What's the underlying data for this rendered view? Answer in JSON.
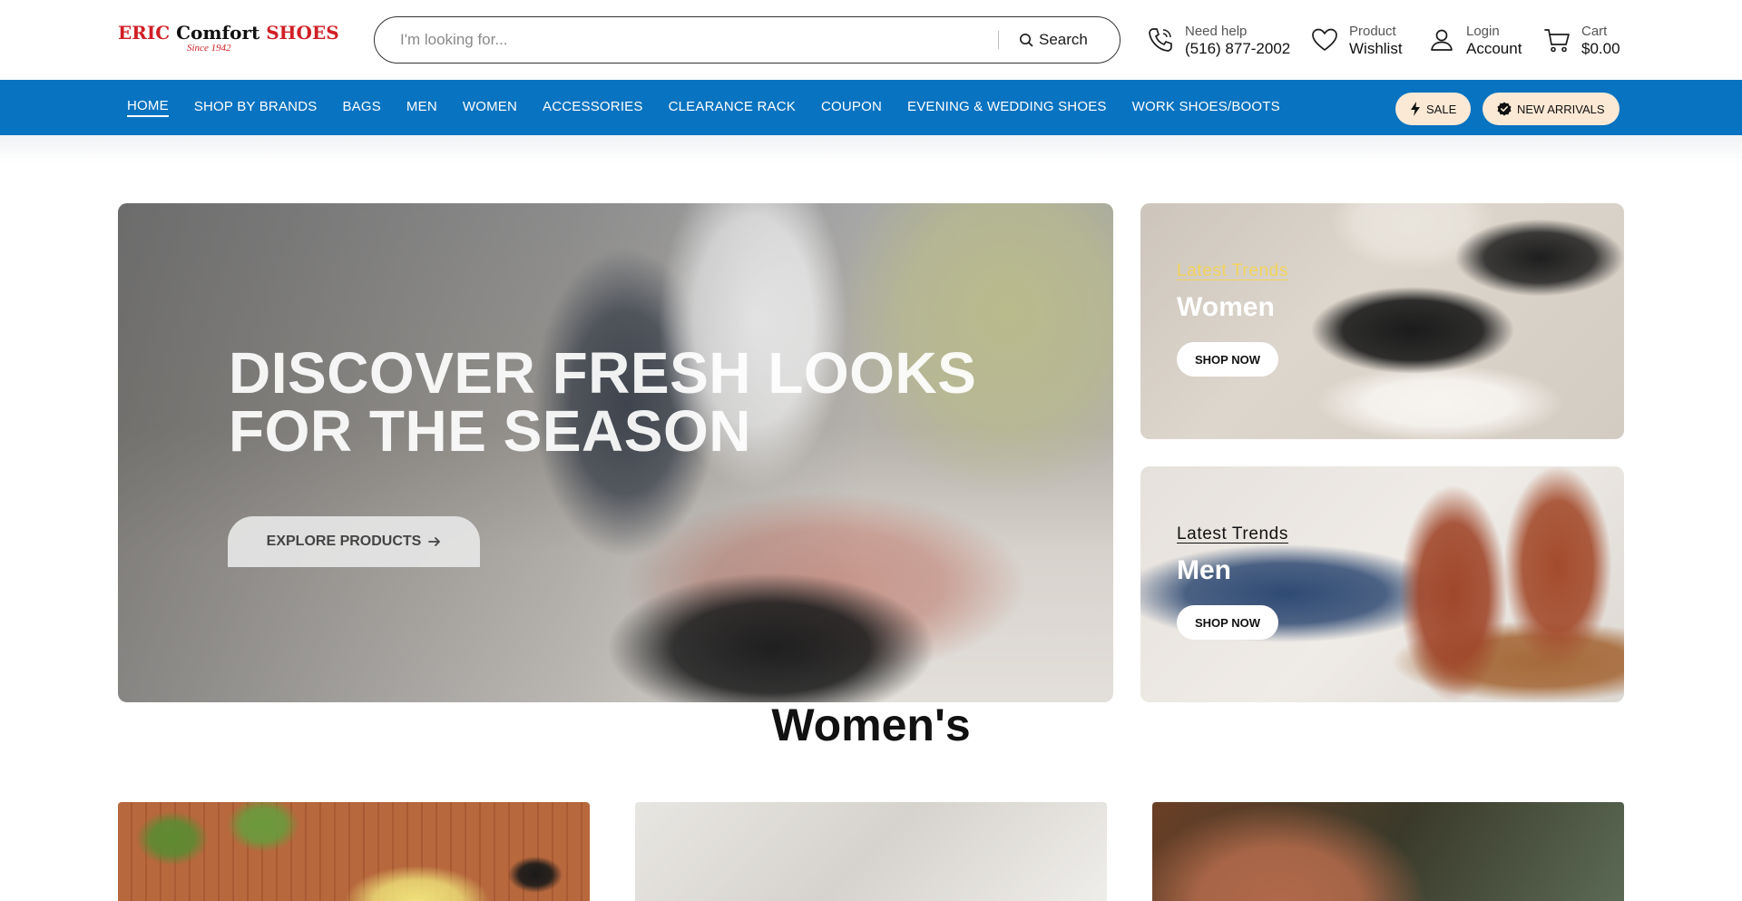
{
  "logo": {
    "brand_red_1": "ERIC",
    "brand_black": "Comfort",
    "brand_red_2": "SHOES",
    "since": "Since 1942"
  },
  "search": {
    "placeholder": "I'm looking for...",
    "button_label": "Search"
  },
  "header_items": {
    "help": {
      "small": "Need help",
      "big": "(516) 877-2002",
      "icon": "phone-icon"
    },
    "wishlist": {
      "small": "Product",
      "big": "Wishlist",
      "icon": "heart-icon"
    },
    "account": {
      "small": "Login",
      "big": "Account",
      "icon": "user-icon"
    },
    "cart": {
      "small": "Cart",
      "big": "$0.00",
      "icon": "cart-icon"
    }
  },
  "nav": {
    "links": [
      "HOME",
      "SHOP BY BRANDS",
      "BAGS",
      "MEN",
      "WOMEN",
      "ACCESSORIES",
      "CLEARANCE RACK",
      "COUPON",
      "EVENING & WEDDING SHOES",
      "WORK SHOES/BOOTS"
    ],
    "active_index": 0,
    "sale_label": "SALE",
    "new_arrivals_label": "NEW ARRIVALS"
  },
  "hero": {
    "title_line1": "DISCOVER FRESH LOOKS",
    "title_line2": "FOR THE SEASON",
    "button_label": "EXPLORE PRODUCTS"
  },
  "promos": {
    "women": {
      "subtitle": "Latest Trends",
      "title": "Women",
      "button": "SHOP NOW"
    },
    "men": {
      "subtitle": "Latest Trends",
      "title": "Men",
      "button": "SHOP NOW"
    }
  },
  "section": {
    "title": "Women's"
  },
  "colors": {
    "nav_bg": "#0773c1",
    "brand_red": "#d01f26",
    "pill_bg": "#fbe9d5",
    "women_subtitle": "#f2d35a"
  }
}
